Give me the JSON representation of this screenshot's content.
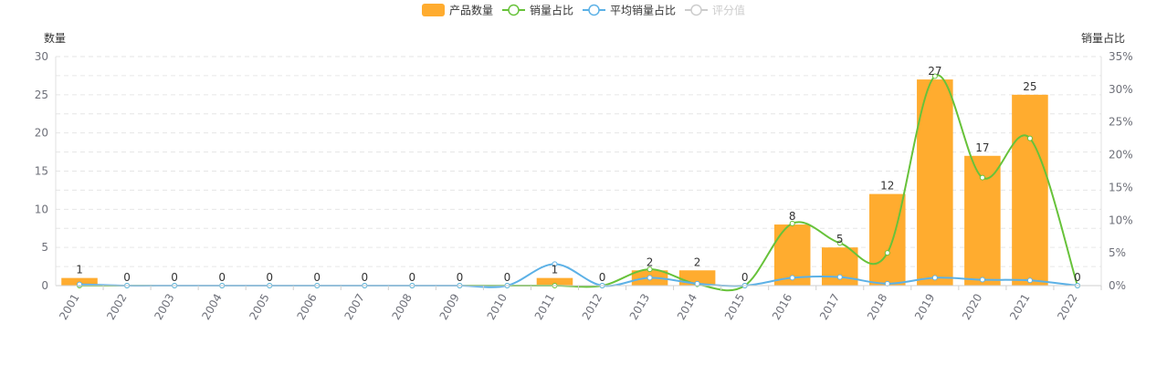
{
  "chart_data": {
    "type": "bar",
    "categories": [
      "2001",
      "2002",
      "2003",
      "2004",
      "2005",
      "2006",
      "2007",
      "2008",
      "2009",
      "2010",
      "2011",
      "2012",
      "2013",
      "2014",
      "2015",
      "2016",
      "2017",
      "2018",
      "2019",
      "2020",
      "2021",
      "2022"
    ],
    "left_axis": {
      "label": "数量",
      "range": [
        0,
        30
      ],
      "ticks": [
        "0",
        "5",
        "10",
        "15",
        "20",
        "25",
        "30"
      ]
    },
    "right_axis": {
      "label": "销量占比",
      "range": [
        0,
        35
      ],
      "ticks": [
        "0%",
        "5%",
        "10%",
        "15%",
        "20%",
        "25%",
        "30%",
        "35%"
      ]
    },
    "grid": true,
    "legend_position": "top-center",
    "series": [
      {
        "name": "产品数量",
        "type": "bar",
        "axis": "left",
        "color": "#ffac2f",
        "values": [
          1,
          0,
          0,
          0,
          0,
          0,
          0,
          0,
          0,
          0,
          1,
          0,
          2,
          2,
          0,
          8,
          5,
          12,
          27,
          17,
          25,
          0
        ],
        "labels": [
          "1",
          "0",
          "0",
          "0",
          "0",
          "0",
          "0",
          "0",
          "0",
          "0",
          "1",
          "0",
          "2",
          "2",
          "0",
          "8",
          "5",
          "12",
          "27",
          "17",
          "25",
          "0"
        ]
      },
      {
        "name": "销量占比",
        "type": "line",
        "axis": "right",
        "color": "#67c23a",
        "values": [
          0,
          0,
          0,
          0,
          0,
          0,
          0,
          0,
          0,
          0,
          0,
          0,
          2.5,
          0.2,
          0,
          9.5,
          6.5,
          5,
          32,
          16.5,
          22.5,
          0
        ]
      },
      {
        "name": "平均销量占比",
        "type": "line",
        "axis": "right",
        "color": "#5cb1e6",
        "values": [
          0.2,
          0,
          0,
          0,
          0,
          0,
          0,
          0,
          0,
          0,
          3.3,
          0,
          1.2,
          0.3,
          0,
          1.2,
          1.3,
          0.3,
          1.2,
          0.9,
          0.8,
          0
        ]
      },
      {
        "name": "评分值",
        "type": "line",
        "axis": "right",
        "color": "#cccccc",
        "hidden": true,
        "values": []
      }
    ]
  }
}
